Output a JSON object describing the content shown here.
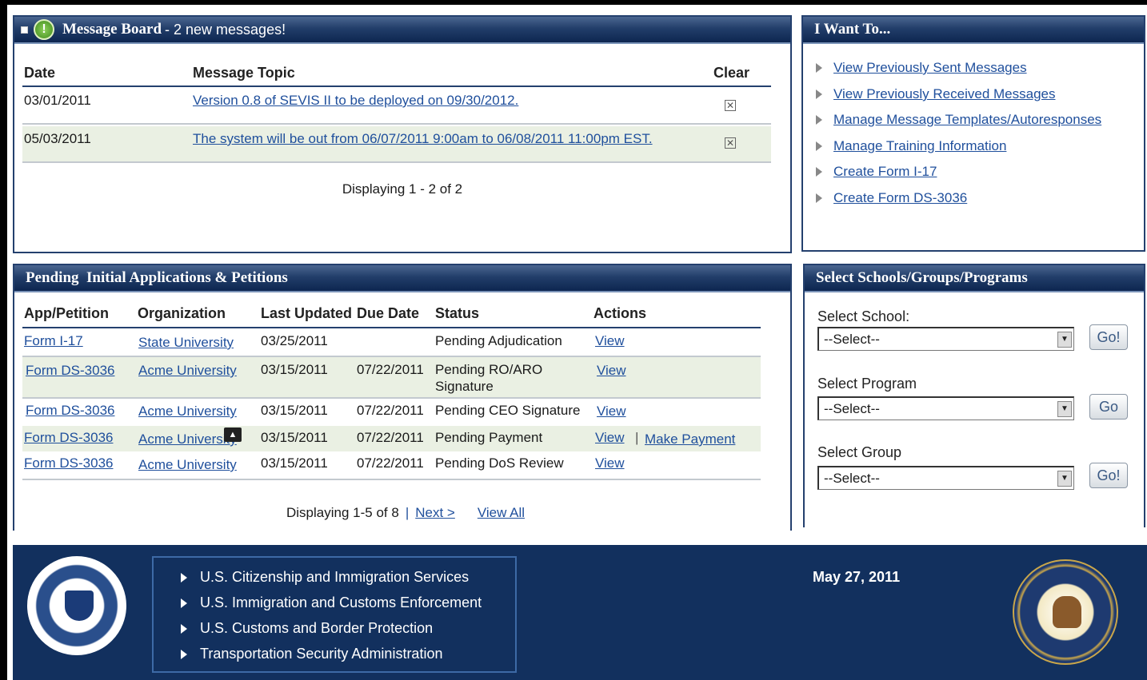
{
  "message_board": {
    "title": "Message Board",
    "subtitle": "- 2 new messages!",
    "headers": {
      "date": "Date",
      "topic": "Message Topic",
      "clear": "Clear"
    },
    "rows": [
      {
        "date": "03/01/2011",
        "topic": "Version 0.8 of SEVIS II to be deployed on 09/30/2012."
      },
      {
        "date": "05/03/2011",
        "topic": "The system will be out from 06/07/2011 9:00am to 06/08/2011 11:00pm EST."
      }
    ],
    "displaying": "Displaying 1 - 2 of 2"
  },
  "i_want_to": {
    "title": "I Want To...",
    "items": [
      "View Previously Sent Messages",
      "View Previously Received Messages",
      "Manage Message Templates/Autoresponses",
      "Manage Training Information",
      "Create Form I-17",
      "Create Form DS-3036"
    ]
  },
  "pending": {
    "title": "Pending  Initial Applications & Petitions",
    "headers": {
      "app": "App/Petition",
      "org": "Organization",
      "updated": "Last Updated",
      "due": "Due Date",
      "status": "Status",
      "actions": "Actions"
    },
    "rows": [
      {
        "app": "Form I-17",
        "org": "State University",
        "updated": "03/25/2011",
        "due": "",
        "status": "Pending Adjudication",
        "action": "View",
        "extra": ""
      },
      {
        "app": "Form DS-3036",
        "org": "Acme University",
        "updated": "03/15/2011",
        "due": "07/22/2011",
        "status": "Pending RO/ARO",
        "status2": "Signature",
        "action": "View",
        "extra": ""
      },
      {
        "app": "Form DS-3036",
        "org": "Acme University",
        "updated": "03/15/2011",
        "due": "07/22/2011",
        "status": "Pending CEO Signature",
        "action": "View",
        "extra": ""
      },
      {
        "app": "Form DS-3036",
        "org": "Acme University",
        "updated": "03/15/2011",
        "due": "07/22/2011",
        "status": "Pending Payment",
        "action": "View",
        "extra": "Make Payment"
      },
      {
        "app": "Form DS-3036",
        "org": "Acme University",
        "updated": "03/15/2011",
        "due": "07/22/2011",
        "status": "Pending DoS Review",
        "action": "View",
        "extra": ""
      }
    ],
    "displaying": "Displaying 1-5 of 8",
    "next": "Next >",
    "view_all": "View All"
  },
  "select_panel": {
    "title": "Select Schools/Groups/Programs",
    "school_label": "Select School:",
    "program_label": "Select Program",
    "group_label": "Select Group",
    "select_value": "--Select--",
    "go_school": "Go!",
    "go_program": "Go",
    "go_group": "Go!"
  },
  "footer": {
    "agencies": [
      "U.S. Citizenship and Immigration Services",
      "U.S. Immigration and Customs Enforcement",
      "U.S. Customs and Border Protection",
      "Transportation Security Administration"
    ],
    "date": "May 27, 2011",
    "dhs_seal_text": "U.S. DEPARTMENT OF HOMELAND SECURITY",
    "dos_seal_text": "DEPARTMENT OF STATE UNITED STATES OF AMERICA"
  }
}
